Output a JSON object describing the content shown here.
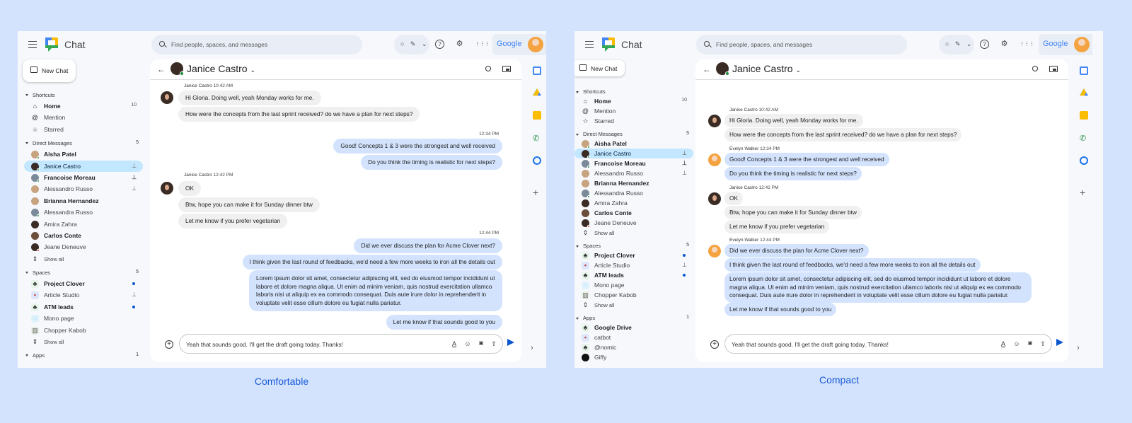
{
  "captions": {
    "comfortable": "Comfortable",
    "compact": "Compact"
  },
  "app": {
    "name": "Chat",
    "search_placeholder": "Find people, spaces, and messages",
    "status_glyphs": "○ ✎ ⌄",
    "help_icon": "?",
    "settings_icon": "⚙",
    "apps_icon": "⋮⋮⋮",
    "brand": "Google",
    "new_chat": "New Chat",
    "shortcuts": {
      "title": "Shortcuts",
      "items": [
        {
          "label": "Home",
          "icon": "home-icon",
          "glyph": "⌂",
          "count": "10",
          "bold": true
        },
        {
          "label": "Mention",
          "icon": "at-icon",
          "glyph": "@"
        },
        {
          "label": "Starred",
          "icon": "star-icon",
          "glyph": "☆"
        }
      ]
    },
    "direct_messages": {
      "title": "Direct Messages",
      "count": "5",
      "items": [
        {
          "label": "Aisha Patel",
          "bold": true
        },
        {
          "label": "Janice Castro",
          "selected": true,
          "pinned": true
        },
        {
          "label": "Francoise Moreau",
          "bold": true,
          "pinned": true
        },
        {
          "label": "Alessandro Russo",
          "pinned": true
        },
        {
          "label": "Brianna Hernandez",
          "bold": true
        },
        {
          "label": "Alessandra Russo"
        },
        {
          "label": "Amira Zahra"
        },
        {
          "label": "Carlos Conte",
          "bold": true
        },
        {
          "label": "Jeane Deneuve"
        }
      ]
    },
    "show_all": "Show all",
    "spaces": {
      "title": "Spaces",
      "count": "5",
      "items": [
        {
          "label": "Project Clover",
          "bold": true,
          "unread": true
        },
        {
          "label": "Article Studio",
          "pinned": true
        },
        {
          "label": "ATM leads",
          "bold": true,
          "unread": true
        },
        {
          "label": "Mono page"
        },
        {
          "label": "Chopper Kabob"
        }
      ]
    },
    "apps": {
      "title": "Apps",
      "count": "1",
      "items": [
        {
          "label": "Google Drive",
          "bold": true
        },
        {
          "label": "catbot"
        },
        {
          "label": "@nomic"
        },
        {
          "label": "Giffy"
        }
      ]
    },
    "pin_glyph": "⊥",
    "chat": {
      "title": "Janice Castro",
      "messages": {
        "m1_sender": "Janice Castro",
        "m1_time": "10:42 AM",
        "m1a": "Hi Gloria. Doing well, yeah Monday works for me.",
        "m1b": "How were the concepts from the last sprint received? do we have a plan for next steps?",
        "m2_sender": "Evelyn Walker",
        "m2_time": "12:34 PM",
        "m2a": "Good! Concepts 1 & 3 were the strongest and well received",
        "m2b": "Do you think the timing is realistic for next steps?",
        "m3_sender": "Janice Castro",
        "m3_time": "12:42 PM",
        "m3a": "OK",
        "m3b": "Btw, hope you can make it for Sunday dinner btw",
        "m3c": "Let me know if you prefer vegetarian",
        "m4_sender": "Evelyn Walker",
        "m4_time": "12:44 PM",
        "m4a": "Did we ever discuss the plan for Acme Clover next?",
        "m4b": "I think given the last round of feedbacks, we'd need a few more weeks to iron all the details out",
        "m4c": "Lorem ipsum dolor sit amet, consectetur adipiscing elit, sed do eiusmod tempor incididunt ut labore et dolore magna aliqua. Ut enim ad minim veniam, quis nostrud exercitation ullamco laboris nisi ut aliquip ex ea commodo consequat. Duis aute irure dolor in reprehenderit in voluptate velit esse cillum dolore eu fugiat nulla pariatur.",
        "m4d": "Let me know if that sounds good to you"
      },
      "compose_value": "Yeah that sounds good. I'll get the draft going today. Thanks!"
    }
  }
}
